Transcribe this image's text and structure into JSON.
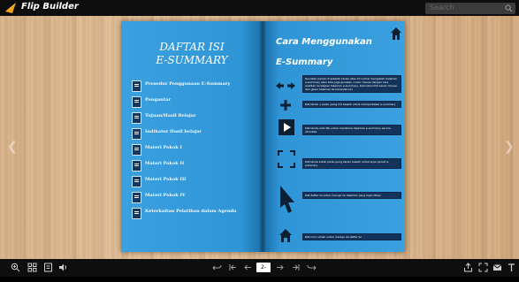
{
  "app": {
    "title": "Flip Builder",
    "search_placeholder": "Search"
  },
  "left_page": {
    "title_line1": "DAFTAR ISI",
    "title_line2": "E-SUMMARY",
    "toc": [
      {
        "label": "Prosedur Penggunaan E-Summary"
      },
      {
        "label": "Pengantar"
      },
      {
        "label": "Tujuan/Hasil Belajar"
      },
      {
        "label": "Indikator Hasil belajar"
      },
      {
        "label": "Materi Pokok I"
      },
      {
        "label": "Materi Pokok II"
      },
      {
        "label": "Materi Pokok III"
      },
      {
        "label": "Materi Pokok IV"
      },
      {
        "label": "Keterkaitan Pelatihan dalam Agenda"
      }
    ]
  },
  "right_page": {
    "title_line1": "Cara Menggunakan",
    "title_line2": "E-Summary",
    "rows": [
      {
        "icon": "arrows-icon",
        "text": "Gunakan panah di sebelah kanan atau kiri untuk mengubah halaman e-summary atau bisa juga gunakan cursor mouse dengan cara arahkan ke bagian halaman e-summary, kemudian klik kanan mouse dan geser halaman ke kanan/ke kiri"
      },
      {
        "icon": "plus-icon",
        "text": "Klik tanda + pada ujung kiri bawah untuk memperbesar e-summary"
      },
      {
        "icon": "play-icon",
        "text": "Klik tanda auto flip untuk membuka halaman e-summary secara otomatis"
      },
      {
        "icon": "fullscreen-icon",
        "text": "Klik tanda kotak pada ujung kanan bawah untuk layar penuh e-summary"
      },
      {
        "icon": "cursor-icon",
        "text": "Klik daftar isi untuk menuju ke halaman yang ingin dituju"
      },
      {
        "icon": "home-icon",
        "text": "Klik icon rumah untuk menuju ke daftar isi"
      }
    ]
  },
  "toolbar": {
    "page_number": "2-3/12"
  },
  "colors": {
    "page_blue": "#2f95d6",
    "box_navy": "#14335a",
    "wood": "#e0bc93"
  }
}
